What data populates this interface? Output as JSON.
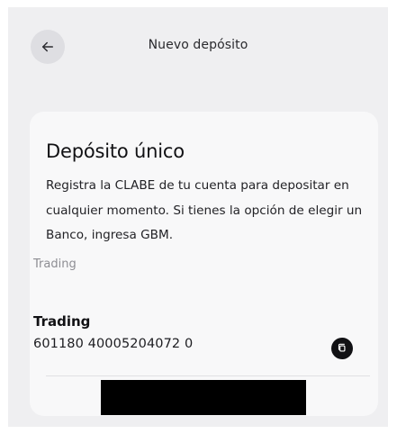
{
  "header": {
    "title": "Nuevo depósito",
    "back_icon": "arrow-left-icon"
  },
  "card": {
    "title": "Depósito único",
    "description": "Registra la CLABE de tu cuenta para depositar en cualquier momento. Si tienes la opción de elegir un Banco, ingresa GBM.",
    "section_label": "Trading",
    "account": {
      "title": "Trading",
      "number": "601180 40005204072 0",
      "copy_icon": "copy-icon"
    }
  },
  "colors": {
    "background": "#efeff1",
    "card": "#f8f8f9",
    "text_primary": "#111114",
    "text_secondary": "#8d8d93",
    "icon_button": "#111114",
    "redaction": "#000000"
  }
}
